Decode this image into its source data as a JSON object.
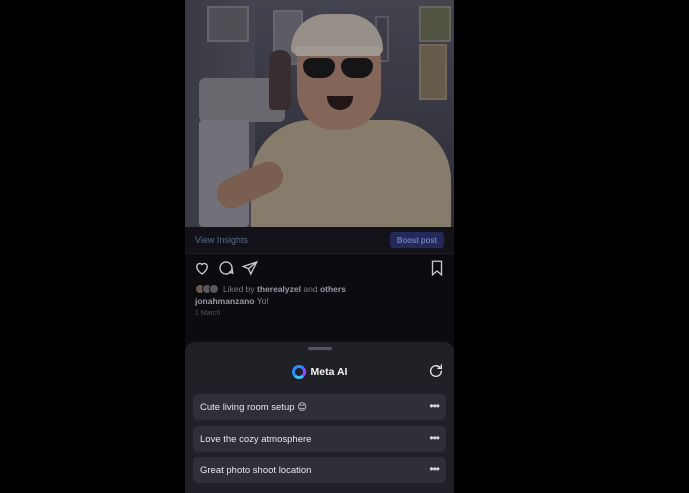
{
  "post": {
    "view_insights": "View Insights",
    "boost_post": "Boost post",
    "liked_prefix": "Liked by",
    "liked_user": "therealyzel",
    "liked_and": "and",
    "liked_others": "others",
    "caption_user": "jonahmanzano",
    "caption_text": "Yo!",
    "date": "1 March",
    "icons": [
      "heart-icon",
      "comment-icon",
      "share-icon",
      "bookmark-icon"
    ]
  },
  "meta_ai": {
    "title": "Meta AI",
    "suggestions": [
      {
        "text": "Cute living room setup 😊"
      },
      {
        "text": "Love the cozy atmosphere"
      },
      {
        "text": "Great photo shoot location"
      }
    ],
    "more_label": "•••"
  },
  "colors": {
    "boost_bg": "#24295a",
    "sheet_bg": "#202127",
    "suggestion_bg": "#2e2f37",
    "meta_blue": "#2a8cff"
  }
}
